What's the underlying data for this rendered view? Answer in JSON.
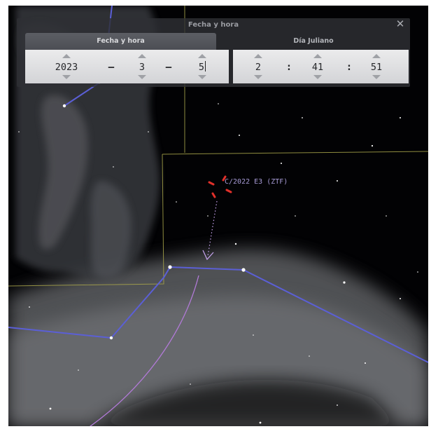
{
  "dialog": {
    "title": "Fecha y hora",
    "close_glyph": "✕",
    "tabs": [
      {
        "label": "Fecha y hora",
        "active": true
      },
      {
        "label": "Día Juliano",
        "active": false
      }
    ],
    "date": {
      "year": "2023",
      "month": "3",
      "day": "5",
      "separator": "–"
    },
    "time": {
      "hour": "2",
      "minute": "41",
      "second": "51",
      "separator": ":"
    }
  },
  "sky": {
    "comet_label": "C/2022 E3 (ZTF)",
    "colors": {
      "background": "#020204",
      "constellation_lines": "#5b5fd6",
      "boundaries": "#a8a54a",
      "ecliptic": "#b27ad8",
      "comet_marker": "#e0302a",
      "comet_trail": "#c8a4f0",
      "milky_way": "#6f7074"
    }
  },
  "icons": {
    "close": "close-icon",
    "spin_up": "arrow-up-icon",
    "spin_down": "arrow-down-icon"
  }
}
